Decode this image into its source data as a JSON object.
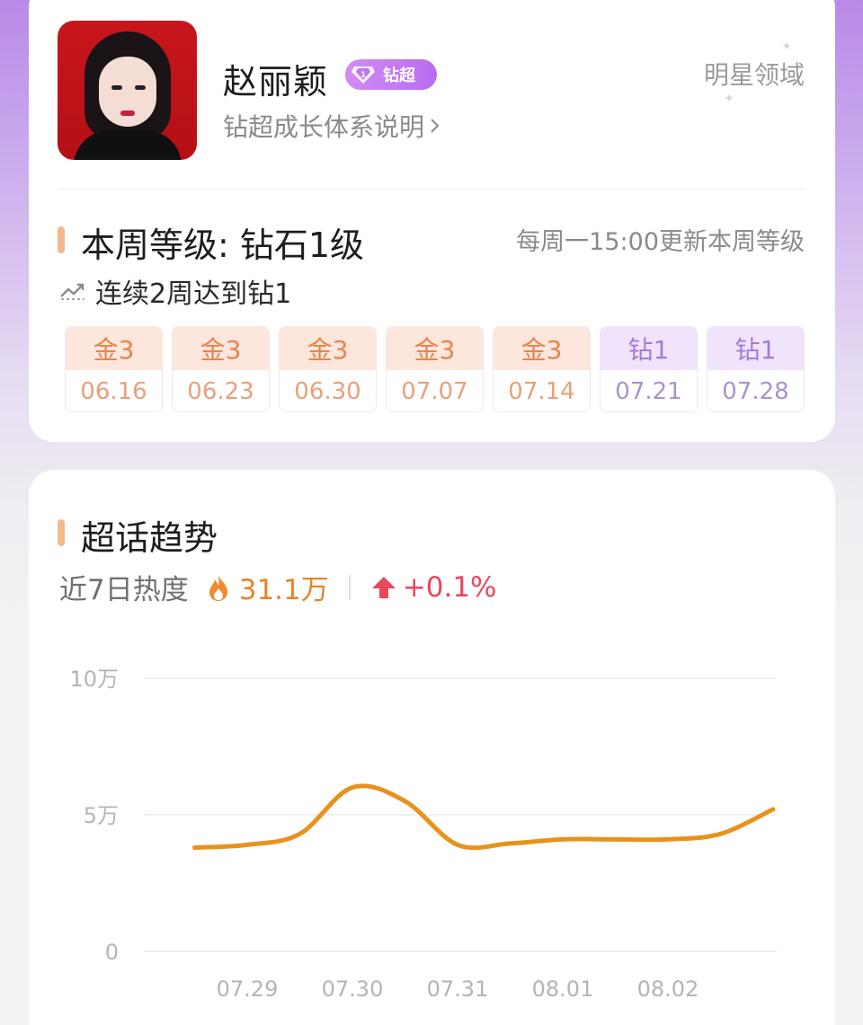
{
  "profile": {
    "name": "赵丽颖",
    "badge_label": "钻超",
    "growth_link": "钻超成长体系说明",
    "domain_label": "明星领域"
  },
  "level": {
    "title": "本周等级: 钻石1级",
    "update_note": "每周一15:00更新本周等级",
    "streak_text": "连续2周达到钻1",
    "weeks": [
      {
        "level": "金3",
        "date": "06.16",
        "tier": "gold"
      },
      {
        "level": "金3",
        "date": "06.23",
        "tier": "gold"
      },
      {
        "level": "金3",
        "date": "06.30",
        "tier": "gold"
      },
      {
        "level": "金3",
        "date": "07.07",
        "tier": "gold"
      },
      {
        "level": "金3",
        "date": "07.14",
        "tier": "gold"
      },
      {
        "level": "钻1",
        "date": "07.21",
        "tier": "diamond"
      },
      {
        "level": "钻1",
        "date": "07.28",
        "tier": "diamond"
      }
    ]
  },
  "trend": {
    "title": "超话趋势",
    "heat_label": "近7日热度",
    "heat_value": "31.1万",
    "change_value": "+0.1%"
  },
  "colors": {
    "accent_orange": "#e3852a",
    "line_color": "#e8921c",
    "up_red": "#e8475e",
    "gold_bg": "#fde6dc",
    "diamond_bg": "#efe4fb"
  },
  "chart_data": {
    "type": "line",
    "x": [
      "07.29",
      "07.30",
      "07.31",
      "08.01",
      "08.02"
    ],
    "y_ticks": [
      "10万",
      "5万",
      "0"
    ],
    "ylim": [
      0,
      10
    ],
    "grid": true,
    "series": [
      {
        "points": [
          {
            "x": "07.28.5",
            "y": 3.8
          },
          {
            "x": "07.29",
            "y": 3.9
          },
          {
            "x": "07.29.5",
            "y": 4.3
          },
          {
            "x": "07.30",
            "y": 6.0
          },
          {
            "x": "07.30.5",
            "y": 5.5
          },
          {
            "x": "07.31",
            "y": 3.9
          },
          {
            "x": "07.31.5",
            "y": 3.95
          },
          {
            "x": "08.01",
            "y": 4.1
          },
          {
            "x": "08.01.5",
            "y": 4.1
          },
          {
            "x": "08.02",
            "y": 4.1
          },
          {
            "x": "08.02.5",
            "y": 4.3
          },
          {
            "x": "08.03",
            "y": 5.2
          }
        ],
        "values": [
          3.8,
          3.9,
          4.3,
          6.0,
          5.5,
          3.9,
          3.95,
          4.1,
          4.1,
          4.1,
          4.3,
          5.2
        ]
      }
    ]
  }
}
